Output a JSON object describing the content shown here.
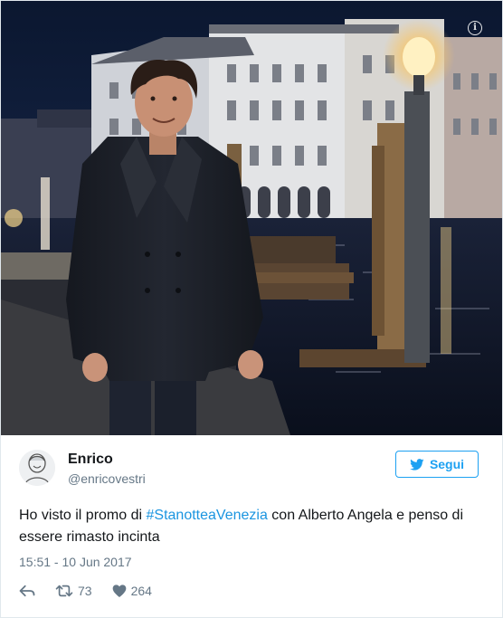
{
  "tweet": {
    "author_name": "Enrico",
    "author_handle": "@enricovestri",
    "text_before": "Ho visto il promo di ",
    "hashtag": "#StanotteaVenezia",
    "text_after": " con Alberto Angela e penso di essere rimasto incinta",
    "timestamp": "15:51 - 10 Jun 2017",
    "retweet_count": "73",
    "like_count": "264"
  },
  "follow_button": {
    "label": "Segui"
  },
  "colors": {
    "accent": "#1da1f2",
    "hashtag": "#1b95e0",
    "secondary_text": "#657786",
    "primary_text": "#14171a"
  },
  "icons": {
    "photo_info": "info-icon",
    "follow": "twitter-bird-icon",
    "reply": "reply-icon",
    "retweet": "retweet-icon",
    "like": "heart-icon"
  }
}
